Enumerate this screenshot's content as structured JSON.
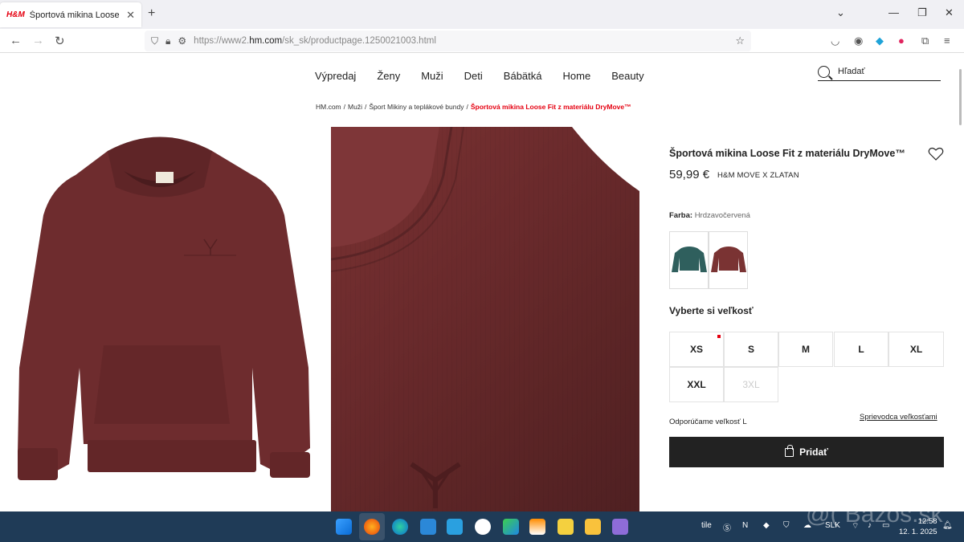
{
  "browser": {
    "tab_title": "Športová mikina Loose Fit z materiálu DryMove™",
    "tab_favicon": "H&M",
    "url_prefix": "https://www2.",
    "url_host": "hm.com",
    "url_path": "/sk_sk/productpage.1250021003.html"
  },
  "site": {
    "menu": [
      "Výpredaj",
      "Ženy",
      "Muži",
      "Deti",
      "Bábätká",
      "Home",
      "Beauty"
    ],
    "search_placeholder": "Hľadať"
  },
  "breadcrumb": {
    "items": [
      "HM.com",
      "Muži",
      "Šport Mikiny a teplákové bundy"
    ],
    "current": "Športová mikina Loose Fit z materiálu DryMove™"
  },
  "product": {
    "title": "Športová mikina Loose Fit z materiálu DryMove™",
    "price": "59,99 €",
    "brand": "H&M MOVE X ZLATAN",
    "color_label": "Farba:",
    "color_value": "Hrdzavočervená",
    "swatch_colors": [
      "#2f5f5d",
      "#7a3333"
    ],
    "size_heading": "Vyberte si veľkosť",
    "sizes": [
      "XS",
      "S",
      "M",
      "L",
      "XL",
      "XXL",
      "3XL"
    ],
    "recommend": "Odporúčame veľkosť L",
    "size_guide": "Sprievodca veľkosťami",
    "add_button": "Pridať",
    "accent_color": "#e50010"
  },
  "taskbar": {
    "tray_text": "tile",
    "lang": "SLK",
    "time": "12:58",
    "date": "12. 1. 2025",
    "watermark": "@( Bazos.sk"
  }
}
